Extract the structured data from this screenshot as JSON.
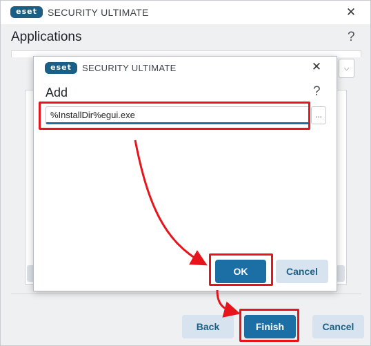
{
  "main_window": {
    "logo": "eset",
    "title": "SECURITY ULTIMATE",
    "close_icon": "✕",
    "page_title": "Applications",
    "help_icon": "?",
    "dropdown_icon": "⌵",
    "buttons": {
      "back": "Back",
      "finish": "Finish",
      "cancel": "Cancel"
    }
  },
  "dialog": {
    "logo": "eset",
    "title": "SECURITY ULTIMATE",
    "close_icon": "✕",
    "heading": "Add",
    "help_icon": "?",
    "path_value": "%InstallDir%egui.exe",
    "browse_label": "...",
    "buttons": {
      "ok": "OK",
      "cancel": "Cancel"
    }
  },
  "colors": {
    "brand": "#1b5e86",
    "primary_button": "#1b6fa5",
    "secondary_button": "#d7e3ee",
    "annotation": "#e8141c"
  }
}
